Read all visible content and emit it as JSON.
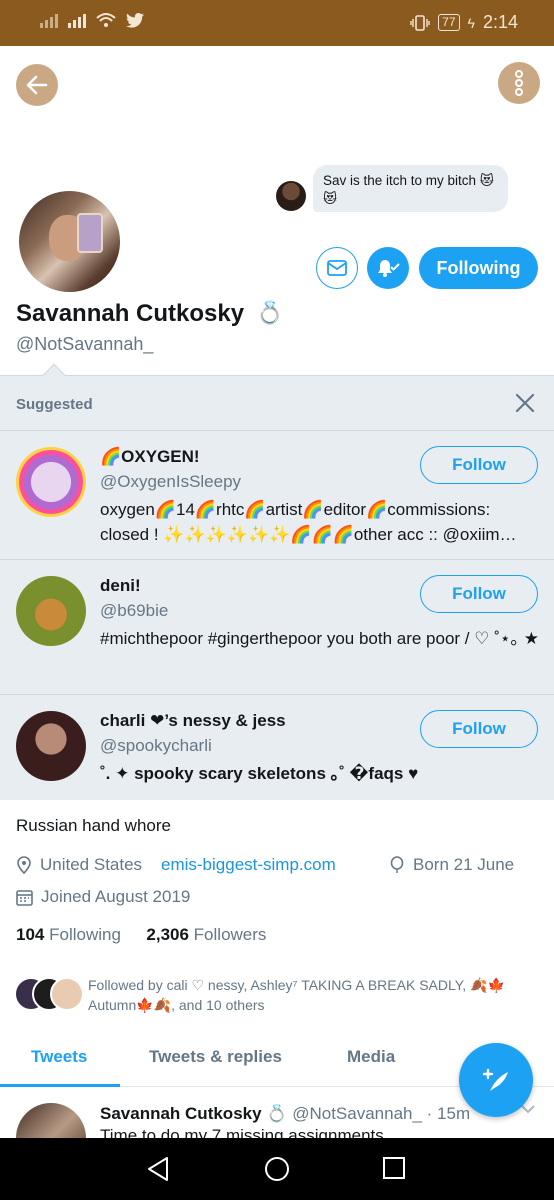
{
  "statusbar": {
    "battery": "77",
    "time": "2:14"
  },
  "dm_preview": {
    "text": "Sav is the itch to my bitch 😻😻"
  },
  "profile": {
    "name": "Savannah Cutkosky",
    "name_emoji": "💍",
    "handle": "@NotSavannah_",
    "following_button": "Following",
    "bio": "Russian hand whore",
    "location": "United States",
    "website": "emis-biggest-simp.com",
    "born": "Born 21 June",
    "joined": "Joined August 2019",
    "following_count": "104",
    "following_label": "Following",
    "followers_count": "2,306",
    "followers_label": "Followers",
    "followed_by": "Followed by cali ♡ nessy, Ashley⁷ TAKING A BREAK SADLY, 🍂🍁Autumn🍁🍂, and 10 others"
  },
  "suggested": {
    "title": "Suggested",
    "items": [
      {
        "name": "🌈OXYGEN!",
        "handle": "@OxygenIsSleepy",
        "bio": "oxygen🌈14🌈rhtc🌈artist🌈editor🌈commissions: closed ! ✨✨✨✨✨✨🌈🌈🌈other acc :: @oxiim…",
        "follow": "Follow"
      },
      {
        "name": "deni!",
        "handle": "@b69bie",
        "bio": "#michthepoor #gingerthepoor you both are poor / ♡ ˚⋆｡ ★",
        "follow": "Follow"
      },
      {
        "name": "charli ❤︎’s nessy & jess",
        "handle": "@spookycharli",
        "bio": "˚. ✦ spooky scary skeletons ｡˚ �faqs ♥",
        "follow": "Follow"
      }
    ]
  },
  "tabs": [
    "Tweets",
    "Tweets & replies",
    "Media"
  ],
  "tweet": {
    "name": "Savannah Cutkosky",
    "emoji": "💍",
    "handle": "@NotSavannah_",
    "time": "· 15m",
    "text": "Time to do my 7 missing assignments"
  },
  "colors": {
    "accent": "#1da1f2",
    "statusbar": "#8a5a1e",
    "nav_button": "#c9a883"
  }
}
